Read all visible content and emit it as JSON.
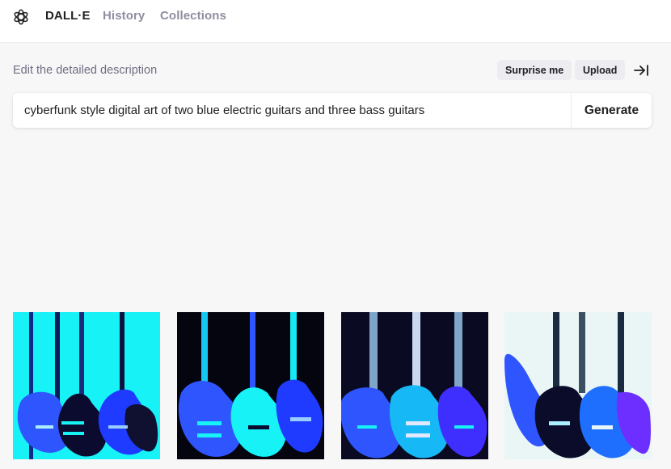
{
  "app": {
    "logo_icon": "openai-logo-icon",
    "nav": [
      {
        "label": "DALL·E",
        "active": true
      },
      {
        "label": "History",
        "active": false
      },
      {
        "label": "Collections",
        "active": false
      }
    ]
  },
  "editor": {
    "label": "Edit the detailed description",
    "surprise_label": "Surprise me",
    "upload_label": "Upload",
    "collapse_icon": "arrow-to-right-icon",
    "prompt_value": "cyberfunk style digital art of two blue electric guitars and three bass guitars",
    "generate_label": "Generate"
  },
  "results": {
    "images": [
      {
        "alt": "cyberfunk guitars image 1",
        "bg": "#16f2f6"
      },
      {
        "alt": "cyberfunk guitars image 2",
        "bg": "#050510"
      },
      {
        "alt": "cyberfunk guitars image 3",
        "bg": "#0a0a22"
      },
      {
        "alt": "cyberfunk guitars image 4",
        "bg": "#eaf6f6"
      }
    ]
  },
  "colors": {
    "accent_cyan": "#16f2f6",
    "guitar_blue": "#2f55ff",
    "background": "#f7f7f8"
  }
}
